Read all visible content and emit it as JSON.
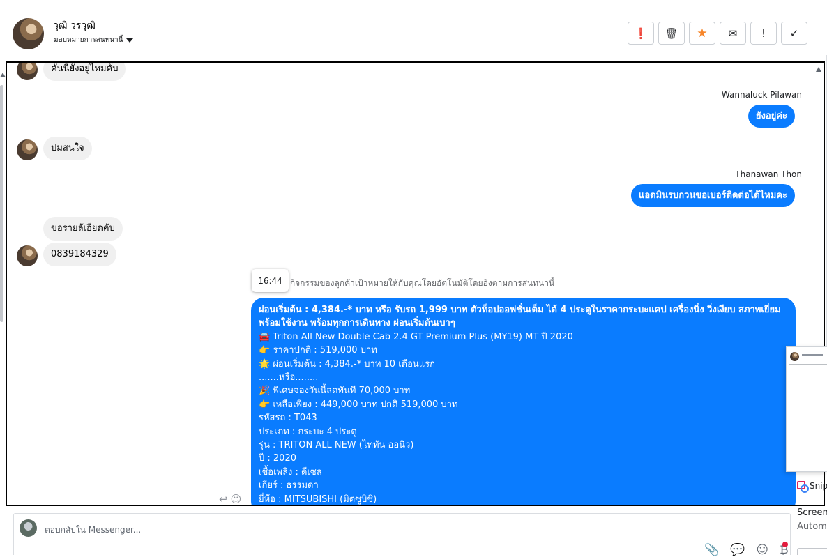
{
  "header": {
    "contact_name": "วุฒิ วรวุฒิ",
    "assign_label": "มอบหมายการสนทนานี้",
    "actions": [
      {
        "name": "spam-button",
        "icon": "alert-circle-icon",
        "glyph": "❗"
      },
      {
        "name": "delete-button",
        "icon": "trash-icon",
        "glyph": "🗑"
      },
      {
        "name": "star-button",
        "icon": "star-icon",
        "glyph": "★"
      },
      {
        "name": "mark-unread-button",
        "icon": "envelope-icon",
        "glyph": "✉"
      },
      {
        "name": "important-button",
        "icon": "exclamation-icon",
        "glyph": "!"
      },
      {
        "name": "done-button",
        "icon": "check-icon",
        "glyph": "✓"
      }
    ]
  },
  "messages": {
    "m1": "คันนี้ยังอยู่ไหมคับ",
    "m2_sender": "Wannaluck Pilawan",
    "m2": "ยังอยู่ค่ะ",
    "m3": "ปมสนใจ",
    "m4_sender": "Thanawan Thon",
    "m4": "แอดมินรบกวนขอเบอร์ติดต่อได้ไหมคะ",
    "m5": "ขอรายลัเอียดคับ",
    "m6": "0839184329",
    "system_note": "งกิจกรรมของลูกค้าเป้าหมายให้กับคุณโดยอัตโนมัติโดยอิงตามการสนทนานี้",
    "tooltip_time": "16:44",
    "listing": {
      "l0": "ผ่อนเริ่มต้น : 4,384.-* บาท หรือ รับรถ 1,999 บาท ตัวท็อปออฟชั่นเต็ม ได้ 4 ประตูในราคากระบะแคป เครื่องนิ่ง วิ่งเงียบ สภาพเยี่ยม พร้อมใช้งาน พร้อมทุกการเดินทาง ผ่อนเริ่มต้นเบาๆ",
      "l1": "🚘 Triton All New Double Cab 2.4 GT Premium Plus (MY19) MT ปี 2020",
      "l2": "👉 ราคาปกติ : 519,000 บาท",
      "l3": "🌟 ผ่อนเริ่มต้น : 4,384.-* บาท 10 เดือนแรก",
      "l4": ".......หรือ........",
      "l5": "🎉 พิเศษจองวันนี้ลดทันที 70,000 บาท",
      "l6": "👉 เหลือเพียง : 449,000 บาท ปกติ 519,000 บาท",
      "l7": " รหัสรถ : T043",
      "l8": " ประเภท : กระบะ 4 ประตู",
      "l9": " รุ่น : TRITON ALL NEW (ไททัน ออนิว)",
      "l10": " ปี : 2020",
      "l11": " เชื้อเพลิง : ดีเซล",
      "l12": " เกียร์ : ธรรมดา",
      "l13": " ยี่ห้อ : MITSUBISHI (มิตซูบิชิ)"
    }
  },
  "composer": {
    "placeholder": "ตอบกลับใน Messenger..."
  },
  "snip_overlay": {
    "app_name": "Snip",
    "title": "Screens",
    "subtitle": "Autom"
  },
  "colors": {
    "outgoing_bubble": "#0a7cff",
    "incoming_bubble": "#f0f0f0",
    "star_accent": "#f7862a"
  }
}
